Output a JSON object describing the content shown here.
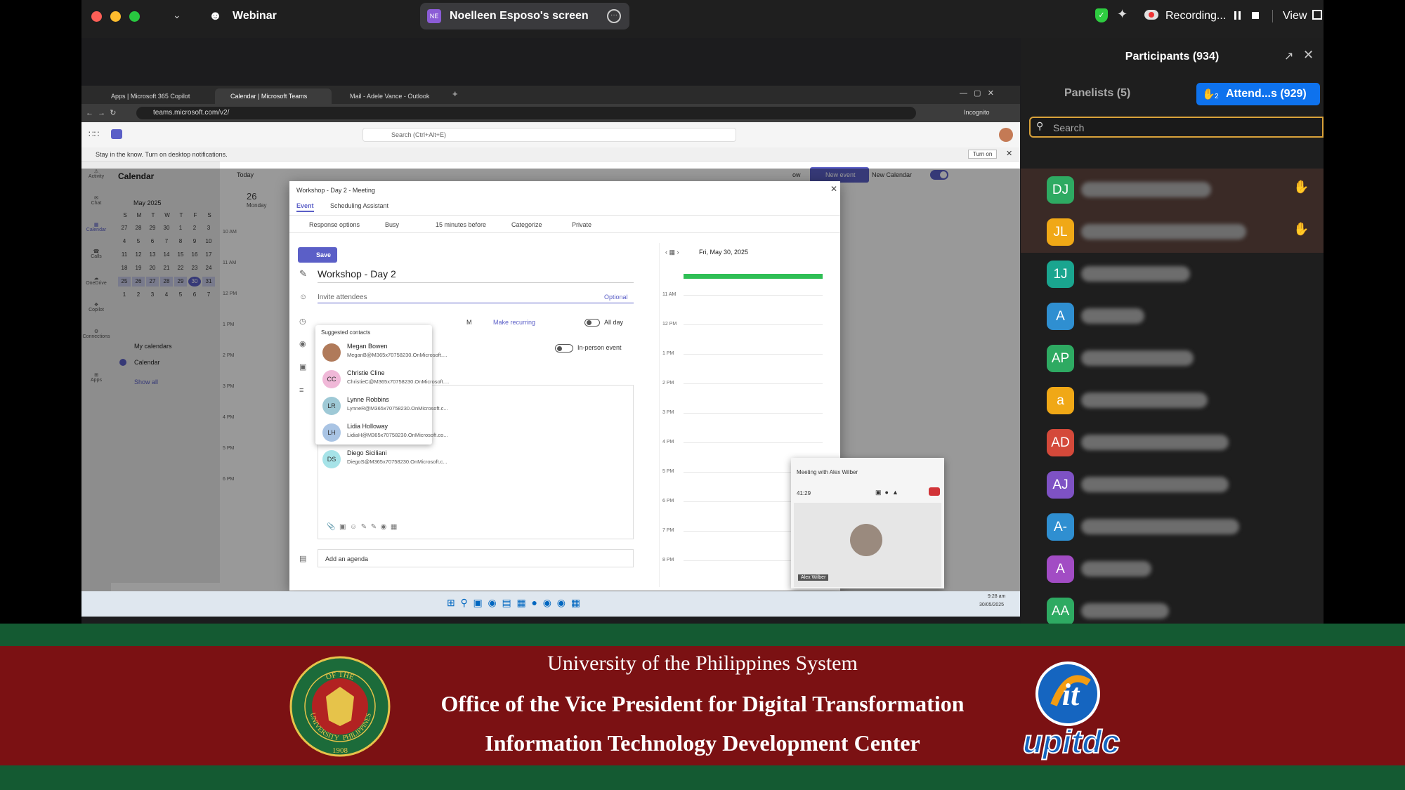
{
  "zoom_bar": {
    "app_label": "Webinar",
    "share_initials": "NE",
    "share_title": "Noelleen Esposo's screen",
    "recording_label": "Recording...",
    "view_label": "View"
  },
  "participants": {
    "title": "Participants (934)",
    "panelists_tab": "Panelists (5)",
    "attendees_tab": "Attend...s (929)",
    "raised_hands_count": "2",
    "search_placeholder": "Search",
    "rows": [
      {
        "initials": "DJ",
        "color": "#2eaa62",
        "hand": true
      },
      {
        "initials": "JL",
        "color": "#f0a816",
        "hand": true
      },
      {
        "initials": "1J",
        "color": "#1aa58f",
        "hand": false
      },
      {
        "initials": "A",
        "color": "#2f8fd1",
        "hand": false
      },
      {
        "initials": "AP",
        "color": "#2eaa62",
        "hand": false
      },
      {
        "initials": "a",
        "color": "#f0a816",
        "hand": false
      },
      {
        "initials": "AD",
        "color": "#d4493a",
        "hand": false
      },
      {
        "initials": "AJ",
        "color": "#7e52c4",
        "hand": false
      },
      {
        "initials": "A-",
        "color": "#2f8fd1",
        "hand": false
      },
      {
        "initials": "A",
        "color": "#a24cc4",
        "hand": false
      },
      {
        "initials": "AA",
        "color": "#2eaa62",
        "hand": false
      }
    ]
  },
  "browser": {
    "tabs": [
      "Apps | Microsoft 365 Copilot",
      "Calendar | Microsoft Teams",
      "Mail - Adele Vance - Outlook"
    ],
    "url": "teams.microsoft.com/v2/",
    "incognito": "Incognito",
    "search_placeholder": "Search (Ctrl+Alt+E)",
    "notification": "Stay in the know. Turn on desktop notifications.",
    "turn_on": "Turn on"
  },
  "teams": {
    "rail": [
      "Activity",
      "Chat",
      "Calendar",
      "Calls",
      "OneDrive",
      "Copilot",
      "Connections",
      "Apps"
    ],
    "calendar_title": "Calendar",
    "today_label": "Today",
    "month_label": "May 2025",
    "weekdays": [
      "S",
      "M",
      "T",
      "W",
      "T",
      "F",
      "S"
    ],
    "days": [
      "27",
      "28",
      "29",
      "30",
      "1",
      "2",
      "3",
      "4",
      "5",
      "6",
      "7",
      "8",
      "9",
      "10",
      "11",
      "12",
      "13",
      "14",
      "15",
      "16",
      "17",
      "18",
      "19",
      "20",
      "21",
      "22",
      "23",
      "24",
      "25",
      "26",
      "27",
      "28",
      "29",
      "30",
      "31",
      "1",
      "2",
      "3",
      "4",
      "5",
      "6",
      "7"
    ],
    "my_calendars": "My calendars",
    "calendar_item": "Calendar",
    "show_all": "Show all",
    "day_num": "26",
    "day_name": "Monday",
    "times": [
      "10 AM",
      "11 AM",
      "12 PM",
      "1 PM",
      "2 PM",
      "3 PM",
      "4 PM",
      "5 PM",
      "6 PM"
    ],
    "new_event": "New event",
    "new_calendar": "New Calendar",
    "view_partial": "ow"
  },
  "dialog": {
    "title": "Workshop - Day 2 - Meeting",
    "tab_event": "Event",
    "tab_assistant": "Scheduling Assistant",
    "response_options": "Response options",
    "busy": "Busy",
    "reminder": "15 minutes before",
    "categorize": "Categorize",
    "private": "Private",
    "save": "Save",
    "event_title": "Workshop - Day 2",
    "invite_placeholder": "Invite attendees",
    "optional": "Optional",
    "suggested": "Suggested contacts",
    "contacts": [
      {
        "initials": "",
        "name": "Megan Bowen",
        "email": "MeganB@M365x70758230.OnMicrosoft....",
        "color": "#b07a5a"
      },
      {
        "initials": "CC",
        "name": "Christie Cline",
        "email": "ChristieC@M365x70758230.OnMicrosoft....",
        "color": "#f0b8d8"
      },
      {
        "initials": "LR",
        "name": "Lynne Robbins",
        "email": "LynneR@M365x70758230.OnMicrosoft.c...",
        "color": "#9ec9d6"
      },
      {
        "initials": "LH",
        "name": "Lidia Holloway",
        "email": "LidiaH@M365x70758230.OnMicrosoft.co...",
        "color": "#a9c4e4"
      },
      {
        "initials": "DS",
        "name": "Diego Siciliani",
        "email": "DiegoS@M365x70758230.OnMicrosoft.c...",
        "color": "#a6e3e8"
      }
    ],
    "time_partial": "M",
    "make_recurring": "Make recurring",
    "all_day": "All day",
    "in_person": "In-person event",
    "add_agenda": "Add an agenda",
    "schedule_date": "Fri, May 30, 2025",
    "schedule_times": [
      "11 AM",
      "12 PM",
      "1 PM",
      "2 PM",
      "3 PM",
      "4 PM",
      "5 PM",
      "6 PM",
      "7 PM",
      "8 PM"
    ]
  },
  "pip": {
    "title": "Meeting with Alex Wilber",
    "timer": "41:29",
    "name": "Alex Wilber"
  },
  "taskbar": {
    "time": "9:28 am",
    "date": "30/05/2025"
  },
  "banner": {
    "line1": "University of the Philippines System",
    "line2": "Office of the Vice President for Digital Transformation",
    "line3": "Information Technology Development Center",
    "seal_text_top": "OF THE",
    "seal_text_left": "UNIVERSITY",
    "seal_text_right": "PHILIPPINES",
    "seal_year": "1908",
    "logo_text": "upitdc",
    "colors": {
      "green": "#145a32",
      "red": "#7b1113"
    }
  }
}
